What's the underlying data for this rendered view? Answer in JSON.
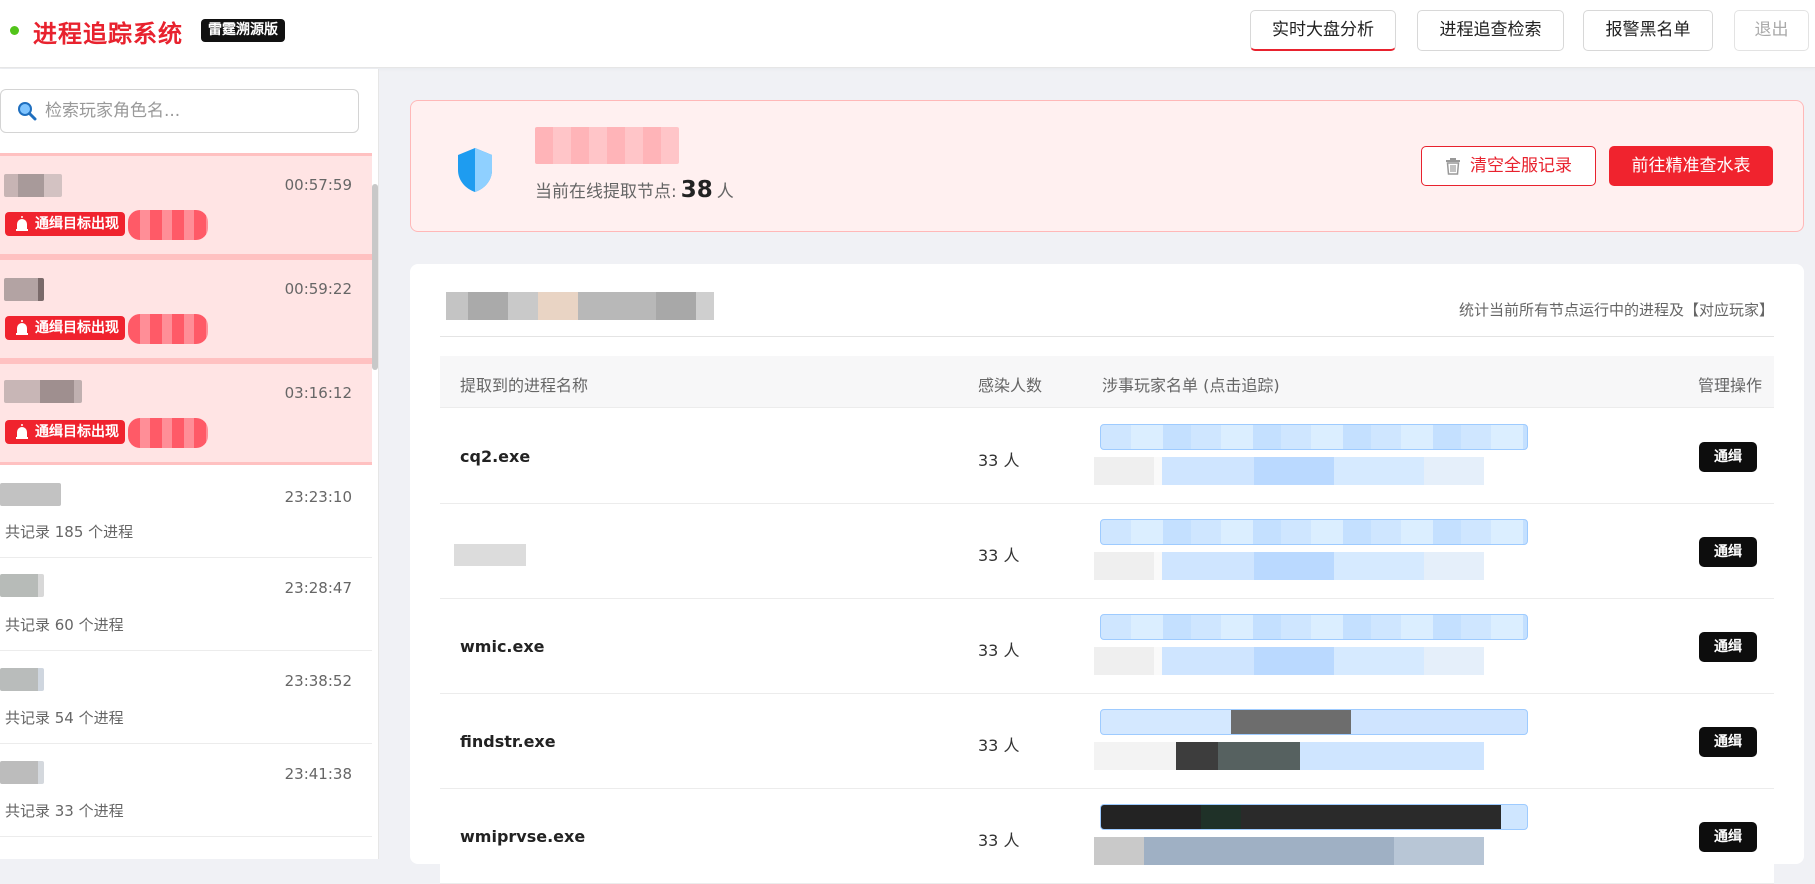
{
  "app": {
    "title": "进程追踪系统",
    "edition": "雷霆溯源版"
  },
  "nav": [
    {
      "label": "实时大盘分析",
      "active": true
    },
    {
      "label": "进程追查检索",
      "active": false
    },
    {
      "label": "报警黑名单",
      "active": false
    },
    {
      "label": "退出",
      "disabled": true
    }
  ],
  "search": {
    "placeholder": "检索玩家角色名..."
  },
  "sessions": [
    {
      "type": "alert",
      "time": "00:57:59",
      "badge": "通缉目标出现"
    },
    {
      "type": "alert",
      "time": "00:59:22",
      "badge": "通缉目标出现"
    },
    {
      "type": "alert",
      "time": "03:16:12",
      "badge": "通缉目标出现"
    },
    {
      "type": "normal",
      "time": "23:23:10",
      "count": "共记录 185 个进程"
    },
    {
      "type": "normal",
      "time": "23:28:47",
      "count": "共记录 60 个进程"
    },
    {
      "type": "normal",
      "time": "23:38:52",
      "count": "共记录 54 个进程"
    },
    {
      "type": "normal",
      "time": "23:41:38",
      "count": "共记录 33 个进程"
    }
  ],
  "panel": {
    "online_label": "当前在线提取节点:",
    "online_count": "38",
    "online_unit": "人",
    "clear_button": "清空全服记录",
    "goto_button": "前往精准查水表"
  },
  "table": {
    "note": "统计当前所有节点运行中的进程及【对应玩家】",
    "headers": [
      "提取到的进程名称",
      "感染人数",
      "涉事玩家名单 (点击追踪)",
      "管理操作"
    ],
    "rows": [
      {
        "process": "cq2.exe",
        "infected": "33 人",
        "action": "通缉"
      },
      {
        "process": "",
        "infected": "33 人",
        "action": "通缉"
      },
      {
        "process": "wmic.exe",
        "infected": "33 人",
        "action": "通缉"
      },
      {
        "process": "findstr.exe",
        "infected": "33 人",
        "action": "通缉"
      },
      {
        "process": "wmiprvse.exe",
        "infected": "33 人",
        "action": "通缉"
      }
    ]
  },
  "colors": {
    "brand_red": "#e8222e",
    "online_dot": "#52c41a",
    "alert_bg": "#ffe4e4",
    "shield_blue": "#1e9cf0"
  }
}
